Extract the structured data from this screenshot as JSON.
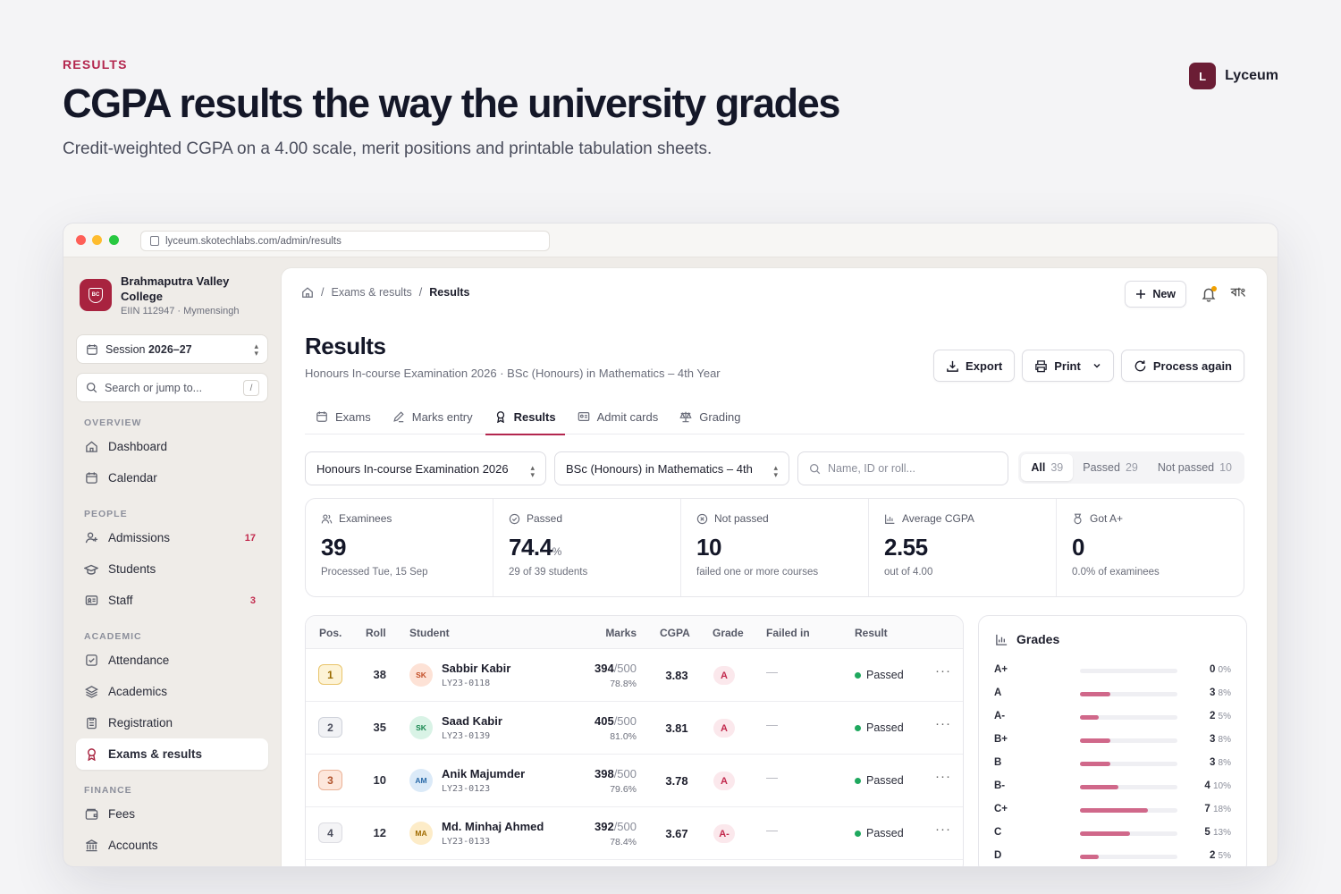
{
  "hero": {
    "eyebrow": "RESULTS",
    "headline": "CGPA results the way the university grades",
    "subline": "Credit-weighted CGPA on a 4.00 scale, merit positions and printable tabulation sheets."
  },
  "brand": {
    "mark": "L",
    "name": "Lyceum"
  },
  "browser": {
    "url": "lyceum.skotechlabs.com/admin/results"
  },
  "sidebar": {
    "college": {
      "crest": "BC",
      "name": "Brahmaputra Valley College",
      "meta": "EIIN 112947 · Mymensingh"
    },
    "session": {
      "label": "Session",
      "value": "2026–27"
    },
    "search": {
      "placeholder": "Search or jump to...",
      "shortcut": "/"
    },
    "sections": [
      {
        "title": "OVERVIEW",
        "items": [
          {
            "label": "Dashboard",
            "icon": "home-icon"
          },
          {
            "label": "Calendar",
            "icon": "calendar-icon"
          }
        ]
      },
      {
        "title": "PEOPLE",
        "items": [
          {
            "label": "Admissions",
            "icon": "user-plus-icon",
            "count": "17"
          },
          {
            "label": "Students",
            "icon": "graduation-cap-icon"
          },
          {
            "label": "Staff",
            "icon": "id-card-icon",
            "count": "3"
          }
        ]
      },
      {
        "title": "ACADEMIC",
        "items": [
          {
            "label": "Attendance",
            "icon": "check-square-icon"
          },
          {
            "label": "Academics",
            "icon": "layers-icon"
          },
          {
            "label": "Registration",
            "icon": "clipboard-icon"
          },
          {
            "label": "Exams & results",
            "icon": "award-icon",
            "active": true
          }
        ]
      },
      {
        "title": "FINANCE",
        "items": [
          {
            "label": "Fees",
            "icon": "wallet-icon"
          },
          {
            "label": "Accounts",
            "icon": "bank-icon"
          }
        ]
      }
    ]
  },
  "header": {
    "breadcrumb": [
      "Exams & results",
      "Results"
    ],
    "new_label": "New",
    "lang": "বাং"
  },
  "page": {
    "title": "Results",
    "context": "Honours In-course Examination 2026 · BSc (Honours) in Mathematics – 4th Year",
    "actions": {
      "export": "Export",
      "print": "Print",
      "process": "Process again"
    }
  },
  "tabs": [
    {
      "label": "Exams",
      "icon": "calendar-icon"
    },
    {
      "label": "Marks entry",
      "icon": "pencil-icon"
    },
    {
      "label": "Results",
      "icon": "award-icon",
      "active": true
    },
    {
      "label": "Admit cards",
      "icon": "id-card-icon"
    },
    {
      "label": "Grading",
      "icon": "scales-icon"
    }
  ],
  "filters": {
    "exam": "Honours In-course Examination 2026",
    "program": "BSc (Honours) in Mathematics – 4th",
    "search_placeholder": "Name, ID or roll...",
    "segments": [
      {
        "label": "All",
        "count": "39",
        "active": true
      },
      {
        "label": "Passed",
        "count": "29"
      },
      {
        "label": "Not passed",
        "count": "10"
      }
    ]
  },
  "stats": [
    {
      "label": "Examinees",
      "value": "39",
      "unit": "",
      "sub": "Processed Tue, 15 Sep",
      "icon": "users-icon"
    },
    {
      "label": "Passed",
      "value": "74.4",
      "unit": "%",
      "sub": "29 of 39 students",
      "icon": "check-circle-icon"
    },
    {
      "label": "Not passed",
      "value": "10",
      "unit": "",
      "sub": "failed one or more courses",
      "icon": "x-circle-icon"
    },
    {
      "label": "Average CGPA",
      "value": "2.55",
      "unit": "",
      "sub": "out of 4.00",
      "icon": "bar-chart-icon"
    },
    {
      "label": "Got A+",
      "value": "0",
      "unit": "",
      "sub": "0.0% of examinees",
      "icon": "medal-icon"
    }
  ],
  "table": {
    "columns": {
      "pos": "Pos.",
      "roll": "Roll",
      "student": "Student",
      "marks": "Marks",
      "cgpa": "CGPA",
      "grade": "Grade",
      "failed_in": "Failed in",
      "result": "Result"
    },
    "rows": [
      {
        "pos": "1",
        "roll": "38",
        "initials": "SK",
        "name": "Sabbir Kabir",
        "id": "LY23-0118",
        "marks": "394",
        "total": "/500",
        "pct": "78.8%",
        "cgpa": "3.83",
        "grade": "A",
        "failed": "—",
        "result": "Passed",
        "pos_style": "gold",
        "av_style": "peach"
      },
      {
        "pos": "2",
        "roll": "35",
        "initials": "SK",
        "name": "Saad Kabir",
        "id": "LY23-0139",
        "marks": "405",
        "total": "/500",
        "pct": "81.0%",
        "cgpa": "3.81",
        "grade": "A",
        "failed": "—",
        "result": "Passed",
        "pos_style": "silver",
        "av_style": "mint"
      },
      {
        "pos": "3",
        "roll": "10",
        "initials": "AM",
        "name": "Anik Majumder",
        "id": "LY23-0123",
        "marks": "398",
        "total": "/500",
        "pct": "79.6%",
        "cgpa": "3.78",
        "grade": "A",
        "failed": "—",
        "result": "Passed",
        "pos_style": "bronze",
        "av_style": "sky"
      },
      {
        "pos": "4",
        "roll": "12",
        "initials": "MA",
        "name": "Md. Minhaj Ahmed",
        "id": "LY23-0133",
        "marks": "392",
        "total": "/500",
        "pct": "78.4%",
        "cgpa": "3.67",
        "grade": "A-",
        "failed": "—",
        "result": "Passed",
        "pos_style": "plain",
        "av_style": "amber"
      }
    ]
  },
  "grades": {
    "title": "Grades",
    "rows": [
      {
        "grade": "A+",
        "count": "0",
        "pct": "0%",
        "share": 0.0
      },
      {
        "grade": "A",
        "count": "3",
        "pct": "8%",
        "share": 0.08
      },
      {
        "grade": "A-",
        "count": "2",
        "pct": "5%",
        "share": 0.05
      },
      {
        "grade": "B+",
        "count": "3",
        "pct": "8%",
        "share": 0.08
      },
      {
        "grade": "B",
        "count": "3",
        "pct": "8%",
        "share": 0.08
      },
      {
        "grade": "B-",
        "count": "4",
        "pct": "10%",
        "share": 0.1
      },
      {
        "grade": "C+",
        "count": "7",
        "pct": "18%",
        "share": 0.18
      },
      {
        "grade": "C",
        "count": "5",
        "pct": "13%",
        "share": 0.13
      },
      {
        "grade": "D",
        "count": "2",
        "pct": "5%",
        "share": 0.05
      }
    ]
  },
  "colors": {
    "accent": "#b3264e",
    "brand": "#6b1d35",
    "pass": "#1fa85e",
    "bar": "#d0688a"
  }
}
